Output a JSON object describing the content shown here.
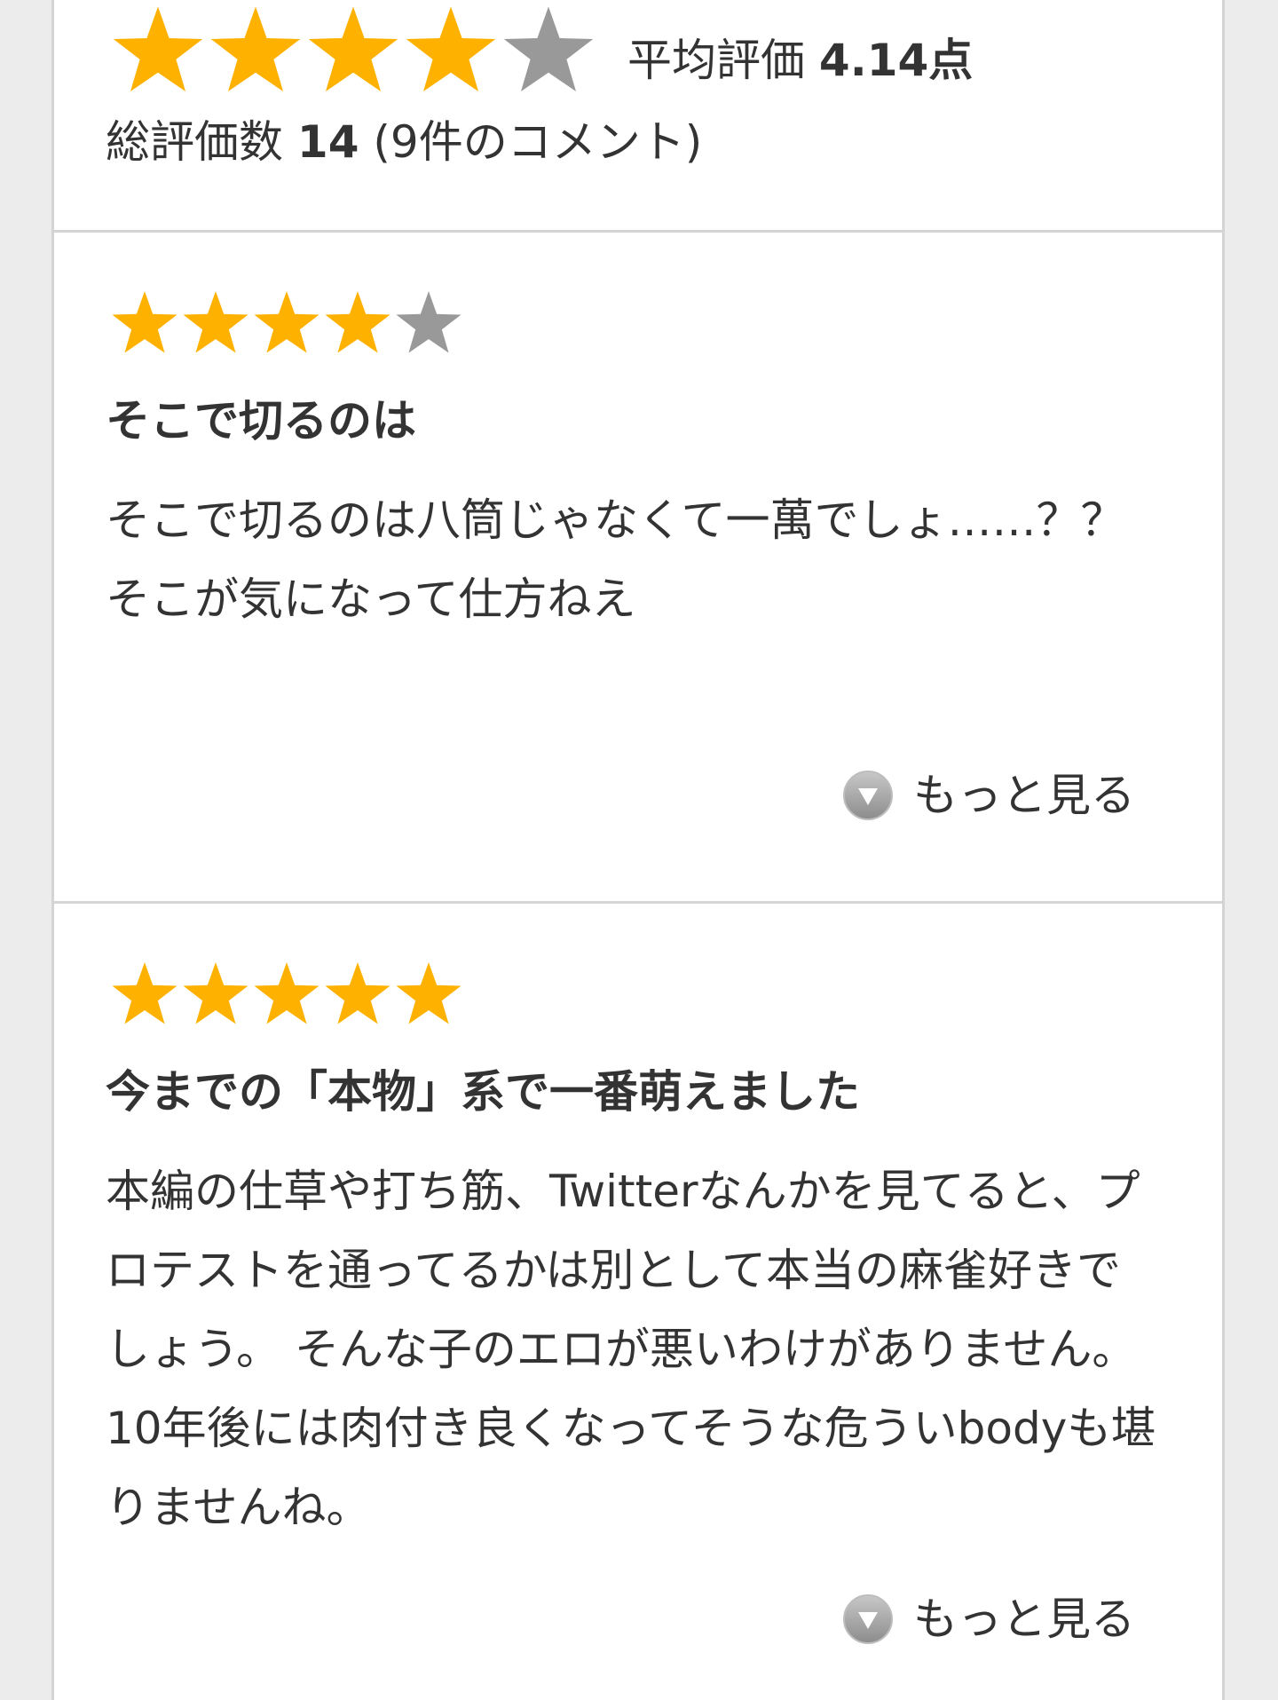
{
  "colors": {
    "star_filled": "#FFB100",
    "star_empty": "#999999",
    "divider": "#d4d4d4",
    "text": "#333333"
  },
  "summary": {
    "rating": 4,
    "max_rating": 5,
    "avg_label": "平均評価",
    "avg_value": "4.14点",
    "total_label": "総評価数",
    "total_value": "14",
    "comment_count_text": "(9件のコメント)"
  },
  "reviews": [
    {
      "rating": 4,
      "title": "そこで切るのは",
      "body": "そこで切るのは八筒じゃなくて一萬でしょ……？？ そこが気になって仕方ねえ",
      "more_label": "もっと見る",
      "more_icon": "triangle-down-circle-icon"
    },
    {
      "rating": 5,
      "title": "今までの「本物」系で一番萌えました",
      "body": "本編の仕草や打ち筋、Twitterなんかを見てると、プロテストを通ってるかは別として本当の麻雀好きでしょう。 そんな子のエロが悪いわけがありません。 10年後には肉付き良くなってそうな危ういbodyも堪りませんね。",
      "more_label": "もっと見る",
      "more_icon": "triangle-down-circle-icon"
    }
  ]
}
